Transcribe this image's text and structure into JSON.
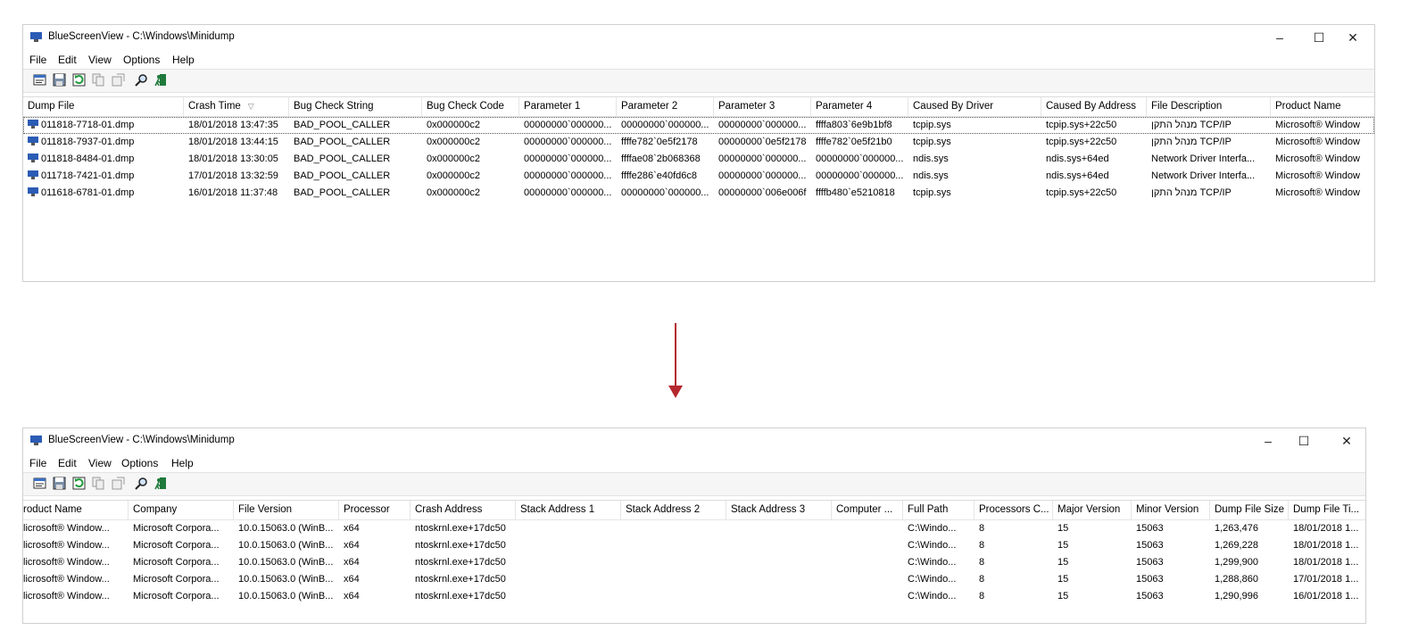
{
  "colors": {
    "arrow": "#b5282e",
    "icon_blue": "#2b5cb5"
  },
  "windows": [
    {
      "title": "BlueScreenView  -  C:\\Windows\\Minidump",
      "controls": {
        "minimize": "–",
        "maximize": "☐",
        "close": "✕"
      },
      "menu": [
        "File",
        "Edit",
        "View",
        "Options",
        "Help"
      ],
      "toolbar_icons": [
        "properties-icon",
        "save-icon",
        "refresh-icon",
        "copy-icon",
        "html-report-icon",
        "find-icon",
        "exit-icon"
      ],
      "columns": [
        "Dump File",
        "Crash Time",
        "Bug Check String",
        "Bug Check Code",
        "Parameter 1",
        "Parameter 2",
        "Parameter 3",
        "Parameter 4",
        "Caused By Driver",
        "Caused By Address",
        "File Description",
        "Product Name"
      ],
      "sort_indicator": "▽",
      "rows": [
        [
          "011818-7718-01.dmp",
          "18/01/2018 13:47:35",
          "BAD_POOL_CALLER",
          "0x000000c2",
          "00000000`000000...",
          "00000000`000000...",
          "00000000`000000...",
          "ffffa803`6e9b1bf8",
          "tcpip.sys",
          "tcpip.sys+22c50",
          "מנהל התקן TCP/IP",
          "Microsoft® Window"
        ],
        [
          "011818-7937-01.dmp",
          "18/01/2018 13:44:15",
          "BAD_POOL_CALLER",
          "0x000000c2",
          "00000000`000000...",
          "ffffe782`0e5f2178",
          "00000000`0e5f2178",
          "ffffe782`0e5f21b0",
          "tcpip.sys",
          "tcpip.sys+22c50",
          "מנהל התקן TCP/IP",
          "Microsoft® Window"
        ],
        [
          "011818-8484-01.dmp",
          "18/01/2018 13:30:05",
          "BAD_POOL_CALLER",
          "0x000000c2",
          "00000000`000000...",
          "ffffae08`2b068368",
          "00000000`000000...",
          "00000000`000000...",
          "ndis.sys",
          "ndis.sys+64ed",
          "Network Driver Interfa...",
          "Microsoft® Window"
        ],
        [
          "011718-7421-01.dmp",
          "17/01/2018 13:32:59",
          "BAD_POOL_CALLER",
          "0x000000c2",
          "00000000`000000...",
          "ffffe286`e40fd6c8",
          "00000000`000000...",
          "00000000`000000...",
          "ndis.sys",
          "ndis.sys+64ed",
          "Network Driver Interfa...",
          "Microsoft® Window"
        ],
        [
          "011618-6781-01.dmp",
          "16/01/2018 11:37:48",
          "BAD_POOL_CALLER",
          "0x000000c2",
          "00000000`000000...",
          "00000000`000000...",
          "00000000`006e006f",
          "ffffb480`e5210818",
          "tcpip.sys",
          "tcpip.sys+22c50",
          "מנהל התקן TCP/IP",
          "Microsoft® Window"
        ]
      ]
    },
    {
      "title": "BlueScreenView  -  C:\\Windows\\Minidump",
      "controls": {
        "minimize": "–",
        "maximize": "☐",
        "close": "✕"
      },
      "menu": [
        "File",
        "Edit",
        "View",
        "Options",
        "Help"
      ],
      "toolbar_icons": [
        "properties-icon",
        "save-icon",
        "refresh-icon",
        "copy-icon",
        "html-report-icon",
        "find-icon",
        "exit-icon"
      ],
      "columns": [
        "roduct Name",
        "Company",
        "File Version",
        "Processor",
        "Crash Address",
        "Stack Address 1",
        "Stack Address 2",
        "Stack Address 3",
        "Computer ...",
        "Full Path",
        "Processors C...",
        "Major Version",
        "Minor Version",
        "Dump File Size",
        "Dump File Ti..."
      ],
      "rows": [
        [
          "licrosoft® Window...",
          "Microsoft Corpora...",
          "10.0.15063.0 (WinB...",
          "x64",
          "ntoskrnl.exe+17dc50",
          "",
          "",
          "",
          "",
          "C:\\Windo...",
          "8",
          "15",
          "15063",
          "1,263,476",
          "18/01/2018 1..."
        ],
        [
          "licrosoft® Window...",
          "Microsoft Corpora...",
          "10.0.15063.0 (WinB...",
          "x64",
          "ntoskrnl.exe+17dc50",
          "",
          "",
          "",
          "",
          "C:\\Windo...",
          "8",
          "15",
          "15063",
          "1,269,228",
          "18/01/2018 1..."
        ],
        [
          "licrosoft® Window...",
          "Microsoft Corpora...",
          "10.0.15063.0 (WinB...",
          "x64",
          "ntoskrnl.exe+17dc50",
          "",
          "",
          "",
          "",
          "C:\\Windo...",
          "8",
          "15",
          "15063",
          "1,299,900",
          "18/01/2018 1..."
        ],
        [
          "licrosoft® Window...",
          "Microsoft Corpora...",
          "10.0.15063.0 (WinB...",
          "x64",
          "ntoskrnl.exe+17dc50",
          "",
          "",
          "",
          "",
          "C:\\Windo...",
          "8",
          "15",
          "15063",
          "1,288,860",
          "17/01/2018 1..."
        ],
        [
          "licrosoft® Window...",
          "Microsoft Corpora...",
          "10.0.15063.0 (WinB...",
          "x64",
          "ntoskrnl.exe+17dc50",
          "",
          "",
          "",
          "",
          "C:\\Windo...",
          "8",
          "15",
          "15063",
          "1,290,996",
          "16/01/2018 1..."
        ]
      ]
    }
  ]
}
